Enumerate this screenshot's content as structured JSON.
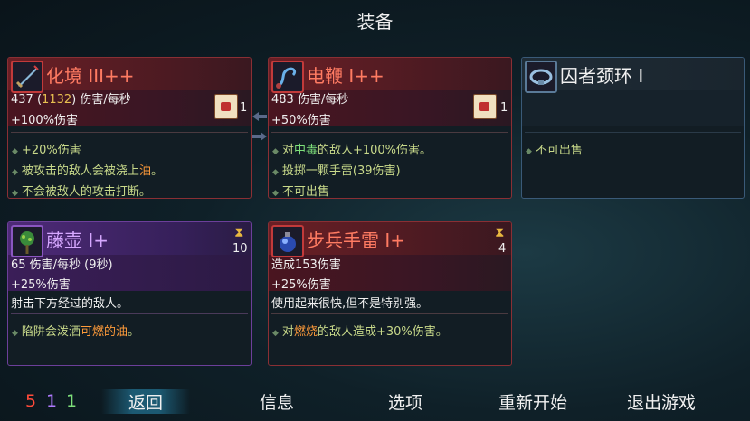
{
  "screen_title": "装备",
  "cards": {
    "c1": {
      "name": "化境 III++",
      "stat1_value": "437",
      "stat1_open": "(",
      "stat1_highlight": "1132",
      "stat1_close": ")",
      "stat1_unit": "伤害/每秒",
      "stat2": "+100%伤害",
      "scroll_count": "1",
      "bullets": [
        "+20%伤害",
        "被攻击的敌人会被浇上",
        "不会被敌人的攻击打断。"
      ],
      "bullet2_highlight": "油",
      "bullet2_tail": "。"
    },
    "c2": {
      "name": "电鞭 I++",
      "stat1": "483 伤害/每秒",
      "stat2": "+50%伤害",
      "scroll_count": "1",
      "b1_pre": "对",
      "b1_hi": "中毒",
      "b1_post": "的敌人+100%伤害。",
      "b2": "投掷一颗手雷(39伤害)",
      "b3": "不可出售"
    },
    "c3": {
      "name": "囚者颈环 I",
      "b1": "不可出售"
    },
    "c4": {
      "name": "藤壶 I+",
      "stat1": "65 伤害/每秒 (9秒)",
      "stat2": "+25%伤害",
      "desc": "射击下方经过的敌人。",
      "b1_pre": "陷阱会泼洒",
      "b1_hi": "可燃的油",
      "b1_post": "。",
      "timer": "10"
    },
    "c5": {
      "name": "步兵手雷 I+",
      "stat1": "造成153伤害",
      "stat2": "+25%伤害",
      "desc": "使用起来很快,但不是特别强。",
      "b1_pre": "对",
      "b1_hi": "燃烧",
      "b1_post": "的敌人造成+30%伤害。",
      "timer": "4"
    }
  },
  "stats": {
    "red": "5",
    "purple": "1",
    "green": "1"
  },
  "menu": {
    "back": "返回",
    "info": "信息",
    "options": "选项",
    "restart": "重新开始",
    "quit": "退出游戏"
  },
  "colors": {
    "red_accent": "#ff7b62",
    "purple_accent": "#d6a8ff",
    "stat_red": "#ff4a3a",
    "stat_purple": "#b07aff",
    "stat_green": "#7ee07a"
  },
  "icons": [
    "sword-icon",
    "whip-icon",
    "collar-icon",
    "vine-icon",
    "grenade-icon",
    "scroll-icon",
    "hourglass-icon"
  ]
}
